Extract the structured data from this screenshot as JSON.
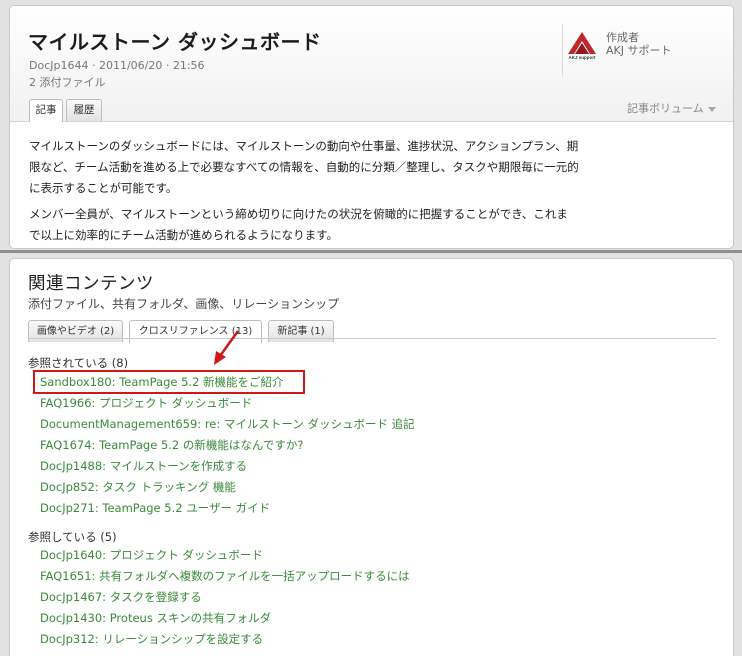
{
  "article": {
    "title": "マイルストーン ダッシュボード",
    "meta": "DocJp1644 · 2011/06/20 · 21:56",
    "attachments": "2 添付ファイル",
    "author_label": "作成者",
    "author_name": "AKJ サポート",
    "logo_text": "AKJ support",
    "tabs": [
      "記事",
      "履歴"
    ],
    "volume_label": "記事ボリューム",
    "paragraphs": [
      "マイルストーンのダッシュボードには、マイルストーンの動向や仕事量、進捗状況、アクションプラン、期限など、チーム活動を進める上で必要なすべての情報を、自動的に分類／整理し、タスクや期限毎に一元的に表示することが可能です。",
      "メンバー全員が、マイルストーンという締め切りに向けたの状況を俯瞰的に把握することができ、これまで以上に効率的にチーム活動が進められるようになります。"
    ]
  },
  "related": {
    "title": "関連コンテンツ",
    "subtitle": "添付ファイル、共有フォルダ、画像、リレーションシップ",
    "tabs": [
      "画像やビデオ (2)",
      "クロスリファレンス (13)",
      "新記事 (1)"
    ],
    "groups": [
      {
        "label": "参照されている (8)",
        "links": [
          "Sandbox180: TeamPage 5.2 新機能をご紹介",
          "FAQ1966: プロジェクト ダッシュボード",
          "DocumentManagement659: re: マイルストーン ダッシュボード 追記",
          "FAQ1674: TeamPage 5.2 の新機能はなんですか?",
          "DocJp1488: マイルストーンを作成する",
          "DocJp852: タスク トラッキング 機能",
          "DocJp271: TeamPage 5.2 ユーザー ガイド"
        ]
      },
      {
        "label": "参照している (5)",
        "links": [
          "DocJp1640: プロジェクト ダッシュボード",
          "FAQ1651: 共有フォルダへ複数のファイルを一括アップロードするには",
          "DocJp1467: タスクを登録する",
          "DocJp1430: Proteus スキンの共有フォルダ",
          "DocJp312: リレーションシップを設定する"
        ]
      }
    ]
  },
  "colors": {
    "link": "#3a8a3a",
    "highlight": "#d01818",
    "logo": "#c0262d"
  },
  "icons": [
    "akj-logo",
    "chevron-down-icon",
    "red-arrow-annotation"
  ]
}
